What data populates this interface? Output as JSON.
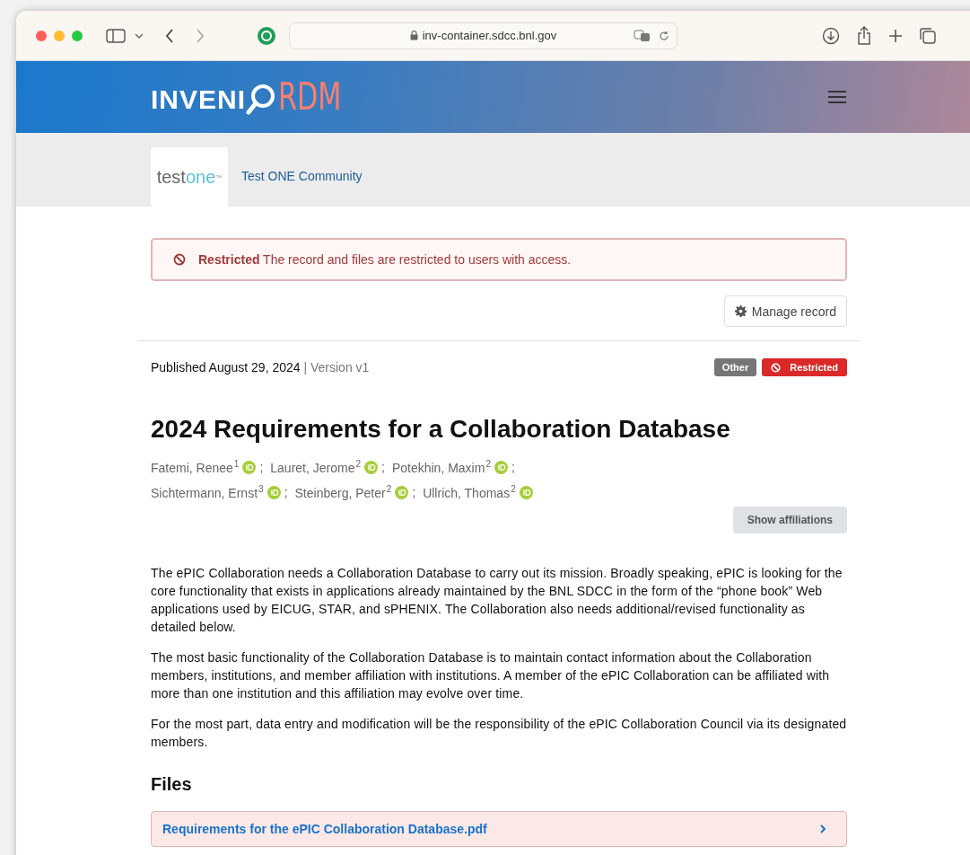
{
  "browser": {
    "url": "inv-container.sdcc.bnl.gov"
  },
  "header": {
    "logo_word": "INVENI",
    "logo_accent": "RDM"
  },
  "community": {
    "logo_part_1": "test",
    "logo_part_2": "one",
    "logo_mark": "™",
    "name": "Test ONE Community"
  },
  "alert": {
    "title": "Restricted",
    "message": "The record and files are restricted to users with access."
  },
  "manage_button": "Manage record",
  "record": {
    "published": "Published August 29, 2024",
    "version_separator": "|",
    "version": "Version v1",
    "labels": [
      {
        "text": "Other",
        "kind": "type"
      },
      {
        "text": "Restricted",
        "kind": "access"
      }
    ],
    "title": "2024 Requirements for a Collaboration Database",
    "creator_lines": [
      [
        {
          "name": "Fatemi, Renee",
          "affiliation": "1"
        },
        {
          "name": "Lauret, Jerome",
          "affiliation": "2"
        },
        {
          "name": "Potekhin, Maxim",
          "affiliation": "2"
        }
      ],
      [
        {
          "name": "Sichtermann, Ernst",
          "affiliation": "3"
        },
        {
          "name": "Steinberg, Peter",
          "affiliation": "2"
        },
        {
          "name": "Ullrich, Thomas",
          "affiliation": "2"
        }
      ]
    ],
    "separator": ";",
    "affiliations_button": "Show affiliations",
    "description": [
      "The ePIC Collaboration needs a Collaboration Database to carry out its mission. Broadly speaking, ePIC is looking for the core functionality that exists in applications already maintained by the BNL SDCC in the form of the “phone book” Web applications used by EICUG, STAR, and sPHENIX. The Collaboration also needs additional/revised functionality as detailed below.",
      "The most basic functionality of the Collaboration Database is to maintain contact information about the Collaboration members, institutions, and member affiliation with institutions. A member of the ePIC Collaboration can be affiliated with more than one institution and this affiliation may evolve over time.",
      "For the most part, data entry and modification will be the responsibility of the ePIC Collaboration Council via its designated members."
    ],
    "files_heading": "Files",
    "file": {
      "name": "Requirements for the ePIC Collaboration Database.pdf",
      "expanded": false
    }
  }
}
